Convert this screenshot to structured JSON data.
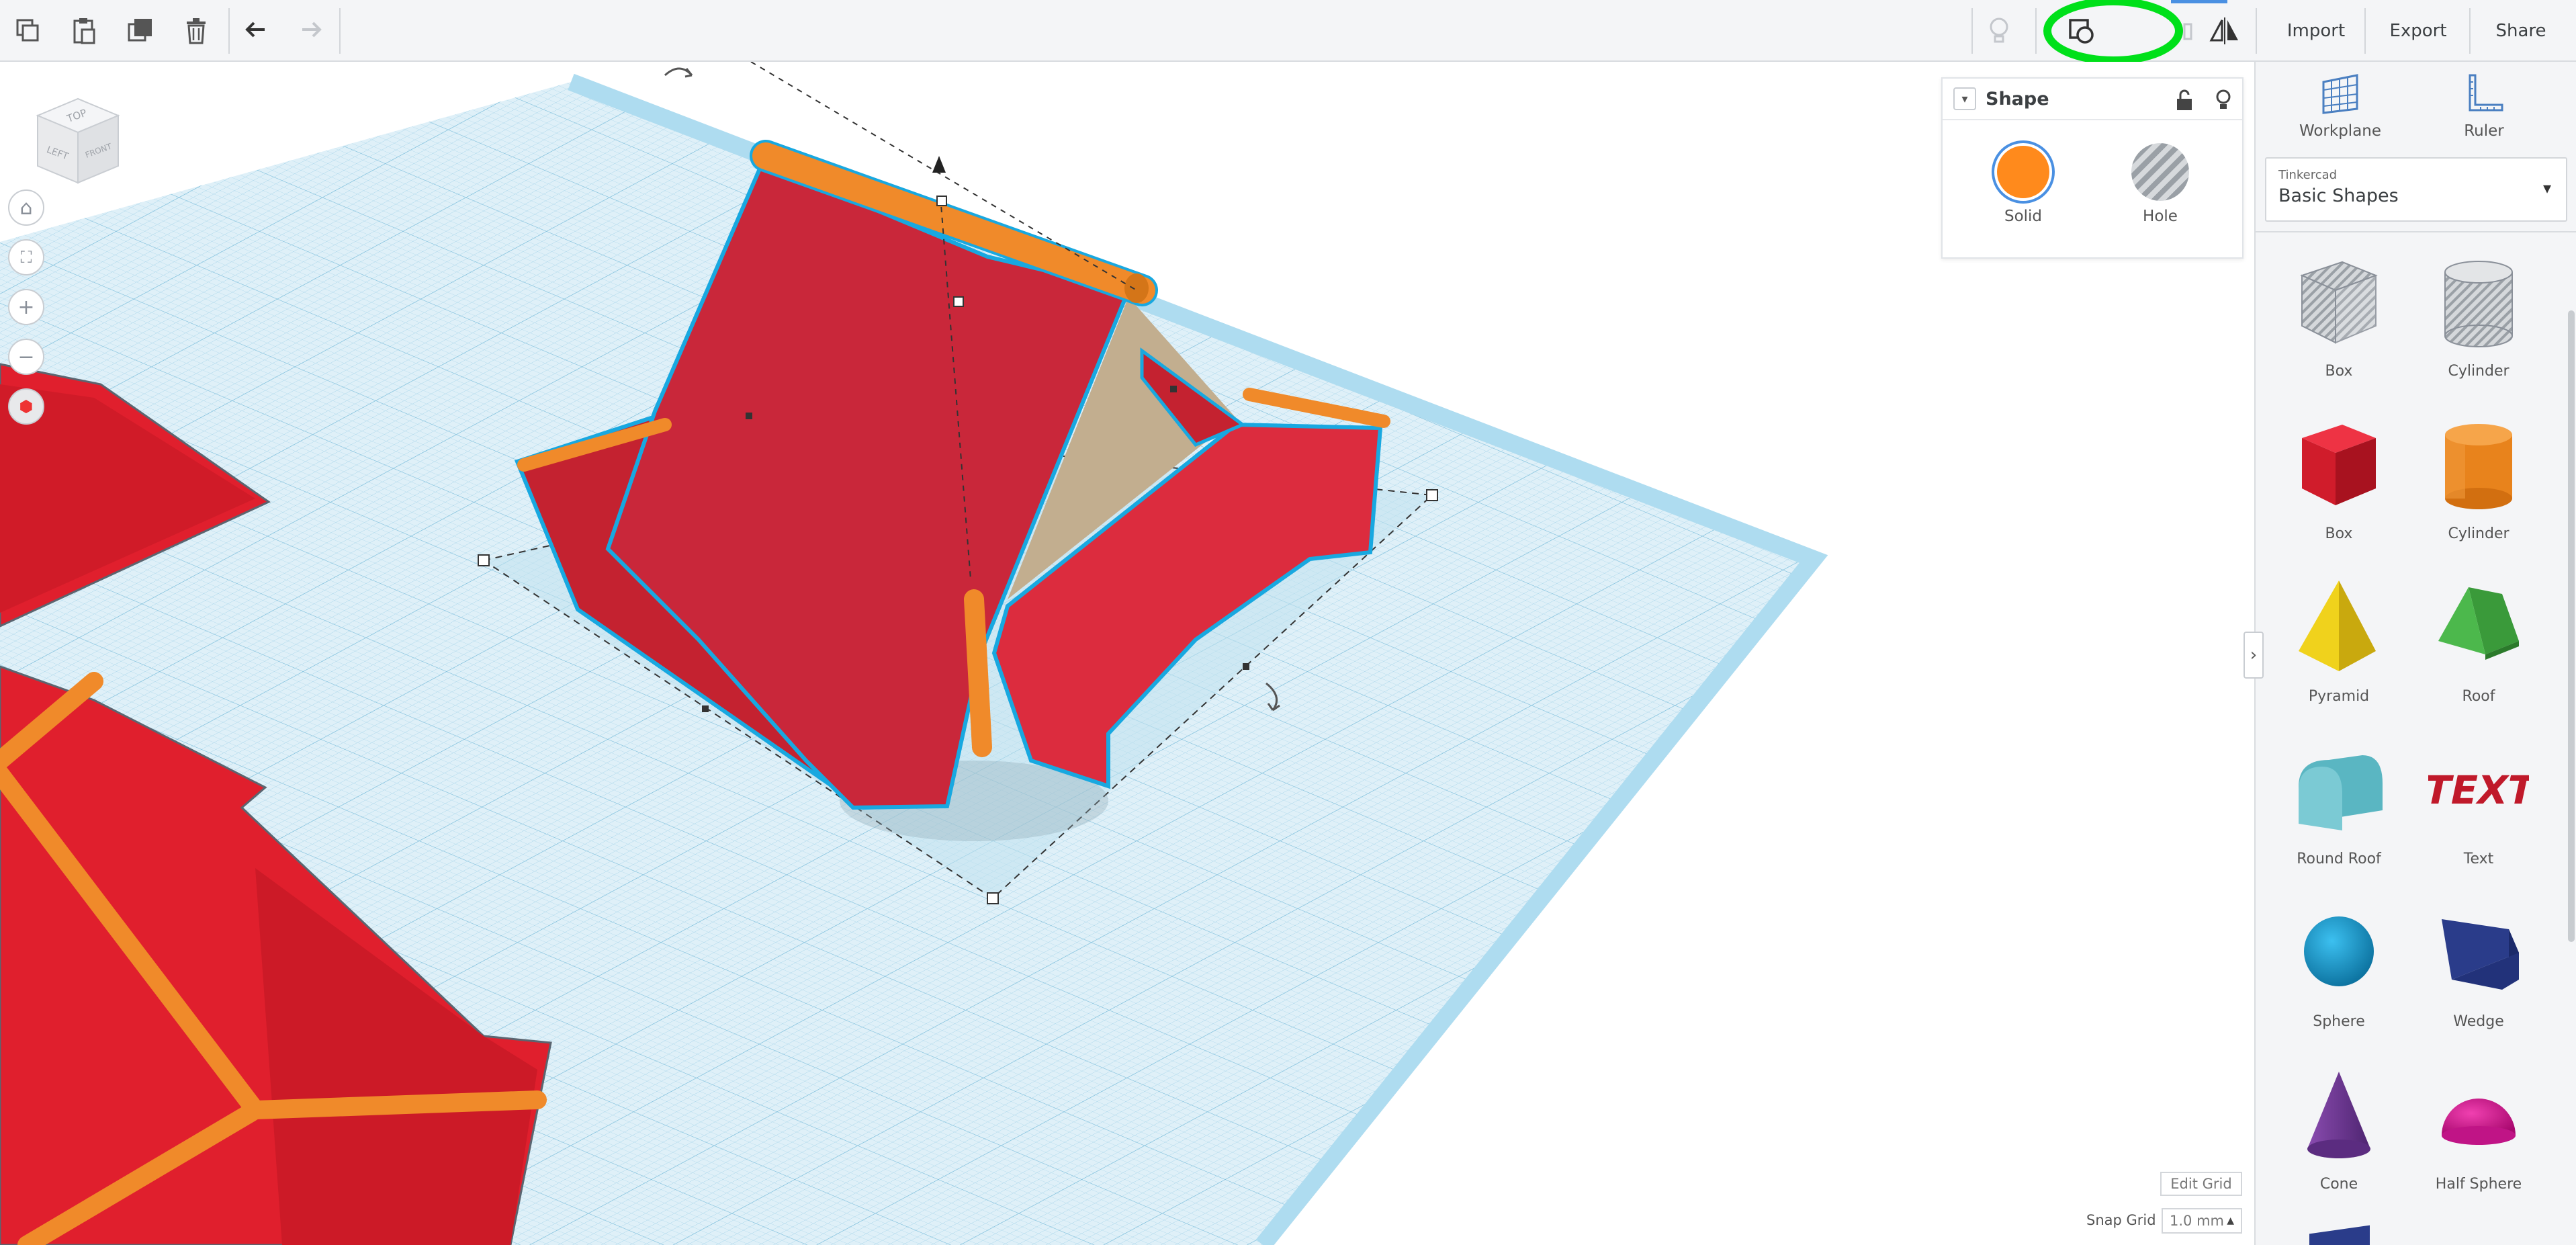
{
  "toolbar": {
    "import_label": "Import",
    "export_label": "Export",
    "share_label": "Share",
    "highlight_color": "#00e01a"
  },
  "viewcube": {
    "top_label": "TOP",
    "left_label": "LEFT",
    "front_label": "FRONT"
  },
  "shape_panel": {
    "title": "Shape",
    "solid_label": "Solid",
    "hole_label": "Hole",
    "solid_color": "#ff8a1c"
  },
  "right_panel": {
    "workplane_label": "Workplane",
    "ruler_label": "Ruler",
    "library_source": "Tinkercad",
    "library_name": "Basic Shapes",
    "shapes": [
      {
        "label": "Box",
        "icon": "box-hole-icon"
      },
      {
        "label": "Cylinder",
        "icon": "cylinder-hole-icon"
      },
      {
        "label": "Box",
        "icon": "box-icon"
      },
      {
        "label": "Cylinder",
        "icon": "cylinder-icon"
      },
      {
        "label": "Pyramid",
        "icon": "pyramid-icon"
      },
      {
        "label": "Roof",
        "icon": "roof-icon"
      },
      {
        "label": "Round Roof",
        "icon": "round-roof-icon"
      },
      {
        "label": "Text",
        "icon": "text-shape-icon"
      },
      {
        "label": "Sphere",
        "icon": "sphere-icon"
      },
      {
        "label": "Wedge",
        "icon": "wedge-icon"
      },
      {
        "label": "Cone",
        "icon": "cone-icon"
      },
      {
        "label": "Half Sphere",
        "icon": "half-sphere-icon"
      }
    ]
  },
  "grid_controls": {
    "edit_grid_label": "Edit Grid",
    "snap_grid_label": "Snap Grid",
    "snap_grid_value": "1.0 mm"
  },
  "colors": {
    "red_solid": "#e0202e",
    "orange_rod": "#f08a2a",
    "workplane": "#cfe9f4",
    "selection": "#18a8e0"
  }
}
